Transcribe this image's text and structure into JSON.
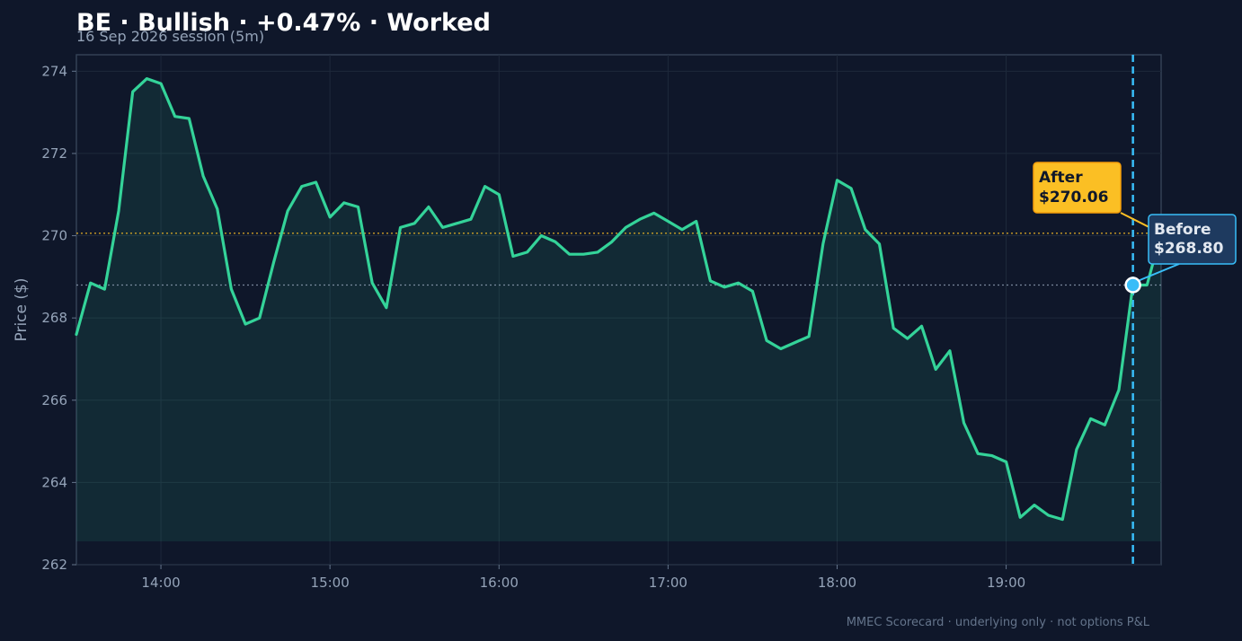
{
  "chart_data": {
    "type": "line",
    "title": "BE · Bullish · +0.47% · Worked",
    "subtitle": "16 Sep 2026 session (5m)",
    "ylabel": "Price ($)",
    "xlabel": "",
    "footer": "MMEC Scorecard · underlying only · not options P&L",
    "ylim": [
      262,
      274.4
    ],
    "yticks": [
      262,
      264,
      266,
      268,
      270,
      272,
      274
    ],
    "xlim": [
      "13:30",
      "19:55"
    ],
    "xticks": [
      "14:00",
      "15:00",
      "16:00",
      "17:00",
      "18:00",
      "19:00"
    ],
    "grid": true,
    "series": [
      {
        "values": [
          [
            "13:30",
            267.6
          ],
          [
            "13:35",
            268.85
          ],
          [
            "13:40",
            268.7
          ],
          [
            "13:45",
            270.6
          ],
          [
            "13:50",
            273.5
          ],
          [
            "13:55",
            273.82
          ],
          [
            "14:00",
            273.7
          ],
          [
            "14:05",
            272.9
          ],
          [
            "14:10",
            272.85
          ],
          [
            "14:15",
            271.45
          ],
          [
            "14:20",
            270.65
          ],
          [
            "14:25",
            268.7
          ],
          [
            "14:30",
            267.85
          ],
          [
            "14:35",
            268.0
          ],
          [
            "14:40",
            269.35
          ],
          [
            "14:45",
            270.6
          ],
          [
            "14:50",
            271.2
          ],
          [
            "14:55",
            271.3
          ],
          [
            "15:00",
            270.45
          ],
          [
            "15:05",
            270.8
          ],
          [
            "15:10",
            270.7
          ],
          [
            "15:15",
            268.85
          ],
          [
            "15:20",
            268.25
          ],
          [
            "15:25",
            270.2
          ],
          [
            "15:30",
            270.3
          ],
          [
            "15:35",
            270.7
          ],
          [
            "15:40",
            270.2
          ],
          [
            "15:45",
            270.3
          ],
          [
            "15:50",
            270.4
          ],
          [
            "15:55",
            271.2
          ],
          [
            "16:00",
            271.0
          ],
          [
            "16:05",
            269.5
          ],
          [
            "16:10",
            269.6
          ],
          [
            "16:15",
            270.0
          ],
          [
            "16:20",
            269.85
          ],
          [
            "16:25",
            269.55
          ],
          [
            "16:30",
            269.55
          ],
          [
            "16:35",
            269.6
          ],
          [
            "16:40",
            269.85
          ],
          [
            "16:45",
            270.2
          ],
          [
            "16:50",
            270.4
          ],
          [
            "16:55",
            270.55
          ],
          [
            "17:00",
            270.35
          ],
          [
            "17:05",
            270.15
          ],
          [
            "17:10",
            270.35
          ],
          [
            "17:15",
            268.9
          ],
          [
            "17:20",
            268.75
          ],
          [
            "17:25",
            268.85
          ],
          [
            "17:30",
            268.65
          ],
          [
            "17:35",
            267.45
          ],
          [
            "17:40",
            267.25
          ],
          [
            "17:45",
            267.4
          ],
          [
            "17:50",
            267.55
          ],
          [
            "17:55",
            269.8
          ],
          [
            "18:00",
            271.35
          ],
          [
            "18:05",
            271.15
          ],
          [
            "18:10",
            270.15
          ],
          [
            "18:15",
            269.8
          ],
          [
            "18:20",
            267.75
          ],
          [
            "18:25",
            267.5
          ],
          [
            "18:30",
            267.8
          ],
          [
            "18:35",
            266.75
          ],
          [
            "18:40",
            267.2
          ],
          [
            "18:45",
            265.45
          ],
          [
            "18:50",
            264.7
          ],
          [
            "18:55",
            264.65
          ],
          [
            "19:00",
            264.5
          ],
          [
            "19:05",
            263.15
          ],
          [
            "19:10",
            263.45
          ],
          [
            "19:15",
            263.2
          ],
          [
            "19:20",
            263.1
          ],
          [
            "19:25",
            264.8
          ],
          [
            "19:30",
            265.55
          ],
          [
            "19:35",
            265.4
          ],
          [
            "19:40",
            266.25
          ],
          [
            "19:45",
            268.8
          ],
          [
            "19:50",
            268.8
          ],
          [
            "19:55",
            270.06
          ]
        ]
      }
    ],
    "markers": {
      "event_time": "19:45",
      "before": {
        "label": "Before",
        "value_text": "$268.80",
        "value": 268.8,
        "time": "19:45"
      },
      "after": {
        "label": "After",
        "value_text": "$270.06",
        "value": 270.06,
        "time": "19:55"
      }
    },
    "colors": {
      "background": "#0f172a",
      "line": "#34d399",
      "before": "#38bdf8",
      "after": "#fbbf24",
      "grid": "#1e293b",
      "text": "#94a3b8"
    }
  }
}
